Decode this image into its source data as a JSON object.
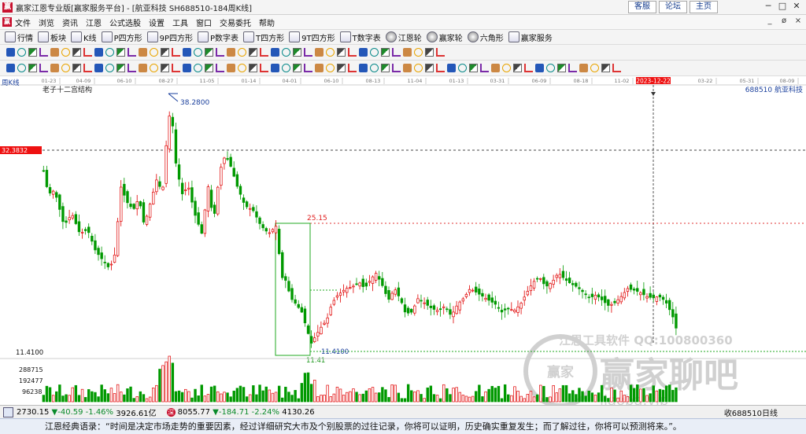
{
  "window": {
    "title": "赢家江恩专业版[赢家服务平台] - [航亚科技  SH688510-184周K线]",
    "links": [
      "客服",
      "论坛",
      "主页"
    ],
    "controls": [
      "─",
      "□",
      "✕"
    ]
  },
  "menu": {
    "items": [
      "文件",
      "浏览",
      "资讯",
      "江恩",
      "公式选股",
      "设置",
      "工具",
      "窗口",
      "交易委托",
      "帮助"
    ],
    "window_controls": [
      "_",
      "ø",
      "×"
    ]
  },
  "toolbar": {
    "items": [
      {
        "label": "行情",
        "icon": "grid-icon"
      },
      {
        "label": "板块",
        "icon": "blocks-icon"
      },
      {
        "label": "K线",
        "icon": "candle-icon"
      },
      {
        "label": "P四方形",
        "icon": "p-square-icon"
      },
      {
        "label": "9P四方形",
        "icon": "9p-square-icon"
      },
      {
        "label": "P数字表",
        "icon": "p-table-icon"
      },
      {
        "label": "T四方形",
        "icon": "t-square-icon"
      },
      {
        "label": "9T四方形",
        "icon": "9t-square-icon"
      },
      {
        "label": "T数字表",
        "icon": "t-table-icon"
      },
      {
        "label": "江恩轮",
        "icon": "gann-wheel-icon"
      },
      {
        "label": "赢家轮",
        "icon": "winner-wheel-icon"
      },
      {
        "label": "六角形",
        "icon": "hexagon-icon"
      },
      {
        "label": "赢家服务",
        "icon": "service-icon"
      }
    ]
  },
  "chart": {
    "period_label": "周K线",
    "study_name": "老子十二宫结构",
    "stock": "688510  航亚科技",
    "x_dates": [
      "01-23",
      "04-09",
      "06-10",
      "08-27",
      "11-05",
      "01-14",
      "04-01",
      "06-10",
      "08-13",
      "11-04",
      "01-13",
      "03-31",
      "06-09",
      "08-18",
      "11-02",
      "2023-12-22",
      "03-22",
      "05-31",
      "08-09"
    ],
    "cursor_date": "2023-12-22",
    "cursor_price": "32.3832",
    "high_label": "38.2800",
    "level_label": "25.15",
    "low_label": "11.41",
    "low_label2": "11.4100",
    "axis_price": "11.4100",
    "volume_ticks": [
      "288715",
      "192477",
      "96238"
    ],
    "watermark_line1": "江恩工具软件  QQ:100800360",
    "watermark_line2": "赢家聊吧",
    "watermark_logo": "赢家",
    "watermark_url": "liaoba.vip"
  },
  "chart_data": {
    "type": "candlestick",
    "period": "weekly",
    "symbol": "SH688510",
    "name": "航亚科技",
    "y_markers": {
      "high": 38.28,
      "cursor": 32.3832,
      "level": 25.15,
      "low": 11.41
    },
    "volume_ticks": [
      288715,
      192477,
      96238
    ]
  },
  "status": {
    "index1_value": "2730.15",
    "index1_change": "▼-40.59",
    "index1_pct": "-1.46%",
    "index1_amount": "3926.61亿",
    "index2_value": "8055.77",
    "index2_change": "▼-184.71",
    "index2_pct": "-2.24%",
    "index2_amount": "4130.26",
    "right_text": "收688510日线"
  },
  "quote": "江恩经典语录：“时间是决定市场走势的重要因素，经过详细研究大市及个别股票的过往记录，你将可以证明，历史确实重复发生；而了解过往，你将可以预测将来。”。",
  "colors": {
    "up": "#e00000",
    "down": "#009900",
    "grid": "#aaaaaa",
    "accent": "#c8102e",
    "cursor_date_bg": "#ee1111"
  }
}
